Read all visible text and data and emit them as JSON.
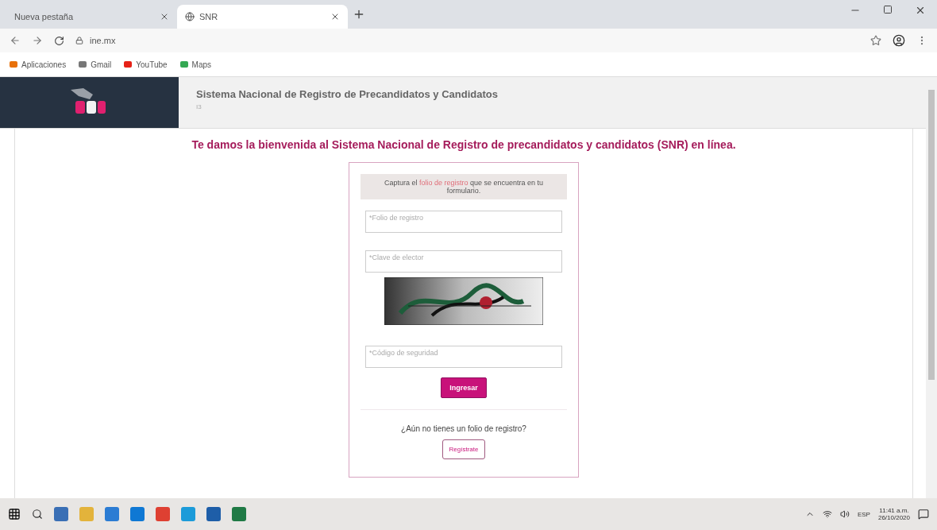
{
  "browser": {
    "tabs": [
      {
        "title": "Nueva pestaña",
        "selected": false
      },
      {
        "title": "SNR",
        "selected": true
      }
    ],
    "url": "ine.mx",
    "bookmarks": [
      {
        "label": "Aplicaciones",
        "color": "#e8710a"
      },
      {
        "label": "Gmail",
        "color": "#777777"
      },
      {
        "label": "YouTube",
        "color": "#e62117"
      },
      {
        "label": "Maps",
        "color": "#34a853"
      }
    ]
  },
  "header": {
    "title": "Sistema Nacional de Registro de Precandidatos y Candidatos",
    "subtitle": "I3"
  },
  "welcome": "Te damos la bienvenida al Sistema Nacional de Registro de precandidatos y candidatos (SNR) en línea.",
  "form": {
    "instruction": {
      "before": "Captura el ",
      "highlight": "folio de registro",
      "after": " que se encuentra en tu formulario."
    },
    "fields": [
      {
        "placeholder": "*Folio de registro"
      },
      {
        "placeholder": "*Clave de elector"
      }
    ],
    "code_field": {
      "placeholder": "*Código de seguridad"
    },
    "submit": "Ingresar",
    "question": "¿Aún no tienes un folio de registro?",
    "register": "Regístrate"
  },
  "taskbar": {
    "apps": [
      {
        "color": "#3a6fb5"
      },
      {
        "color": "#e3b33b"
      },
      {
        "color": "#2b7cd3"
      },
      {
        "color": "#0f78d4"
      },
      {
        "color": "#de4032"
      },
      {
        "color": "#1c9bd9"
      },
      {
        "color": "#1e5ea8"
      },
      {
        "color": "#1f7a45"
      }
    ],
    "language": "ESP",
    "time": "11:41 a.m.",
    "date": "26/10/2020"
  }
}
